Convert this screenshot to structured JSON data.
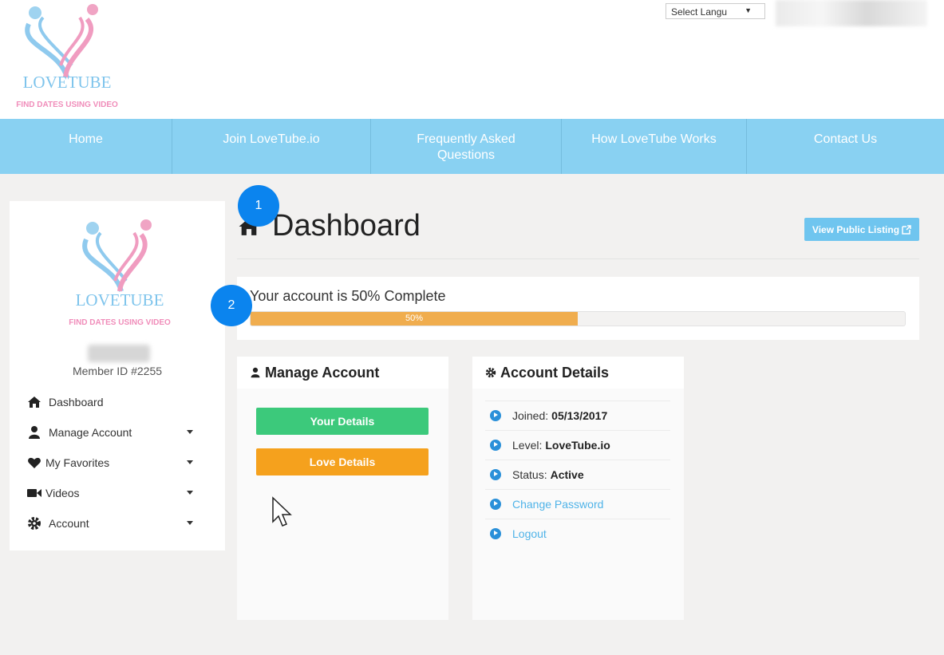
{
  "header": {
    "logo": {
      "name": "LOVETUBE",
      "tagline": "FIND DATES USING VIDEO"
    },
    "language_select": {
      "value": "Select Langu"
    }
  },
  "nav": {
    "items": [
      {
        "label": "Home"
      },
      {
        "label": "Join LoveTube.io"
      },
      {
        "label": "Frequently Asked Questions"
      },
      {
        "label": "How LoveTube Works"
      },
      {
        "label": "Contact Us"
      }
    ]
  },
  "sidebar": {
    "logo": {
      "name": "LOVETUBE",
      "tagline": "FIND DATES USING VIDEO"
    },
    "member_id": "Member ID #2255",
    "menu": [
      {
        "label": "Dashboard",
        "icon": "home-icon"
      },
      {
        "label": "Manage Account",
        "icon": "user-icon"
      },
      {
        "label": "My Favorites",
        "icon": "heart-icon"
      },
      {
        "label": "Videos",
        "icon": "video-camera-icon"
      },
      {
        "label": "Account",
        "icon": "gear-icon"
      }
    ]
  },
  "main": {
    "title": "Dashboard",
    "public_listing_button": "View Public Listing",
    "progress": {
      "text": "Your account is 50% Complete",
      "label": "50%",
      "value": 0.5,
      "color": "#f0ad4e"
    },
    "badges": [
      "1",
      "2"
    ],
    "manage_account": {
      "title": "Manage Account",
      "buttons": [
        {
          "label": "Your Details",
          "color": "#3cc97b"
        },
        {
          "label": "Love Details",
          "color": "#f5a11d"
        }
      ]
    },
    "account_details": {
      "title": "Account Details",
      "joined_label": "Joined:",
      "joined_value": "05/13/2017",
      "level_label": "Level:",
      "level_value": "LoveTube.io",
      "status_label": "Status:",
      "status_value": "Active",
      "change_password": "Change Password",
      "logout": "Logout"
    }
  },
  "colors": {
    "nav_bg": "#89d1f2",
    "accent_blue": "#6fc5ef",
    "badge_blue": "#0b84ee"
  }
}
